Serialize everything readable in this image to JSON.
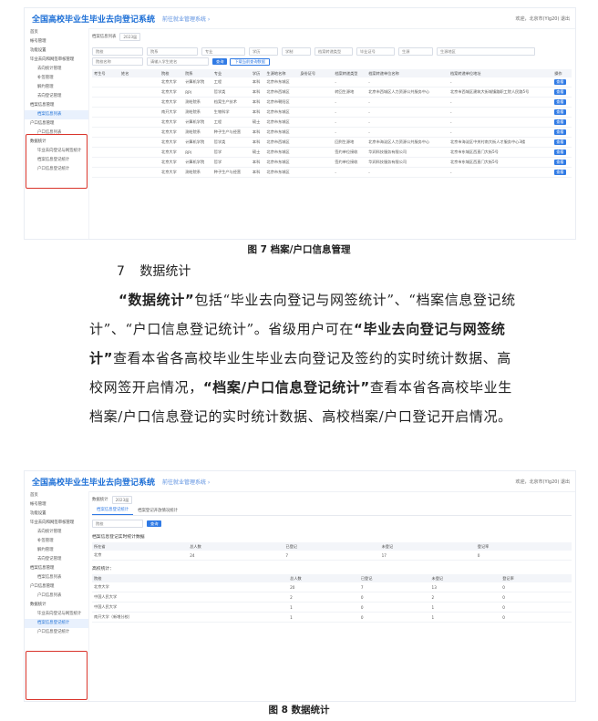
{
  "fig7": {
    "app_title": "全国高校毕业生毕业去向登记系统",
    "app_link": "前往就业管理系统 ›",
    "user": "欢迎，北京市(Ylg20)  退出",
    "year_label": "档案信息列表",
    "year_value": "2023届",
    "sidebar": [
      "首页",
      "帐号管理",
      "功能设置",
      "毕业去向和网签审核管理",
      "去向统计管理",
      "补签管理",
      "解约管理",
      "去向登记管理",
      "档案信息管理",
      "档案信息列表",
      "户口信息管理",
      "户口信息列表",
      "数据统计",
      "毕业去向登记与网签统计",
      "档案信息登记统计",
      "户口信息登记统计"
    ],
    "filters": [
      "院校",
      "院系",
      "专业",
      "学历",
      "学制",
      "档案转递类型",
      "毕业证号",
      "生源",
      "生源地区"
    ],
    "search_placeholder": "院校名称",
    "search_placeholder2": "请输入学生姓名",
    "search_btn": "查询",
    "export_btn": "下载当前查询数据",
    "headers": [
      "考生号",
      "姓名",
      "院校",
      "院系",
      "专业",
      "学历",
      "生源地名称",
      "身份证号",
      "档案转递类型",
      "档案转递单位名称",
      "档案转递单位地址",
      "操作"
    ],
    "rows": [
      [
        "",
        "",
        "北京大学",
        "计算机学院",
        "工程",
        "本科",
        "北京市东城区",
        "",
        "-",
        "-",
        "-",
        "查看"
      ],
      [
        "",
        "",
        "北京大学",
        "RPI",
        "哲学类",
        "本科",
        "北京市西城区",
        "",
        "转回生源地",
        "北京市西城区人力资源公共服务中心",
        "北京市西城区建筑大街城镇路职工院人民路5号",
        "查看"
      ],
      [
        "",
        "",
        "北京大学",
        "测绘院系",
        "档案生产技术",
        "本科",
        "北京市朝阳区",
        "",
        "-",
        "-",
        "-",
        "查看"
      ],
      [
        "",
        "",
        "南开大学",
        "测绘院系",
        "生物科学",
        "本科",
        "北京市东城区",
        "",
        "-",
        "-",
        "-",
        "查看"
      ],
      [
        "",
        "",
        "北京大学",
        "计算机学院",
        "工程",
        "硕士",
        "北京市东城区",
        "",
        "-",
        "-",
        "-",
        "查看"
      ],
      [
        "",
        "",
        "北京大学",
        "测绘院系",
        "种子生产与经营",
        "本科",
        "北京市东城区",
        "",
        "-",
        "-",
        "-",
        "查看"
      ],
      [
        "",
        "",
        "北京大学",
        "计算机学院",
        "哲学类",
        "本科",
        "北京市西城区",
        "",
        "回到生源地",
        "北京市海淀区人力资源公共服务中心",
        "北京市海淀区中关村南大街人才服务中心3楼",
        "查看"
      ],
      [
        "",
        "",
        "北京大学",
        "RPI",
        "哲学",
        "硕士",
        "北京市东城区",
        "",
        "签约单位接收",
        "华润科技服务有限公司",
        "北京市东城区西直门大街5号",
        "查看"
      ],
      [
        "",
        "",
        "北京大学",
        "计算机学院",
        "哲学",
        "本科",
        "北京市东城区",
        "",
        "签约单位接收",
        "华润科技服务有限公司",
        "北京市东城区西直门大街5号",
        "查看"
      ],
      [
        "",
        "",
        "北京大学",
        "测绘院系",
        "种子生产与经营",
        "本科",
        "北京市东城区",
        "",
        "-",
        "-",
        "-",
        "查看"
      ]
    ],
    "caption": "图 7  档案/户口信息管理"
  },
  "section": {
    "number": "7",
    "title": "数据统计"
  },
  "para": {
    "t1": "“数据统计”",
    "t2": "包括“毕业去向登记与网签统计”、“档案信息登记统计”、“户口信息登记统计”。省级用户可在",
    "t3": "“毕业去向登记与网签统计”",
    "t4": "查看本省各高校毕业生毕业去向登记及签约的实时统计数据、高校网签开启情况，",
    "t5": "“档案/户口信息登记统计”",
    "t6": "查看本省各高校毕业生档案/户口信息登记的实时统计数据、高校档案/户口登记开启情况。"
  },
  "fig8": {
    "app_title": "全国高校毕业生毕业去向登记系统",
    "app_link": "前往就业管理系统 ›",
    "user": "欢迎，北京市(Ylg20)  退出",
    "year_label": "数据统计",
    "year_value": "2023届",
    "tabs": [
      "档案信息登记统计",
      "档案登记开放情况统计"
    ],
    "select_placeholder": "院校",
    "query_btn": "查询",
    "summary_title": "档案信息登记实时统计数据",
    "summary_headers": [
      "所在省",
      "总人数",
      "已登记",
      "未登记",
      "登记率"
    ],
    "summary_row": [
      "北京",
      "24",
      "7",
      "17",
      "0"
    ],
    "detail_title": "高校统计：",
    "detail_headers": [
      "院校",
      "总人数",
      "已登记",
      "未登记",
      "登记率"
    ],
    "detail_rows": [
      [
        "北京大学",
        "20",
        "7",
        "13",
        "0"
      ],
      [
        "中国人民大学",
        "2",
        "0",
        "2",
        "0"
      ],
      [
        "中国人民大学",
        "1",
        "0",
        "1",
        "0"
      ],
      [
        "南开大学（新增分校）",
        "1",
        "0",
        "1",
        "0"
      ]
    ],
    "sidebar": [
      "首页",
      "帐号管理",
      "功能设置",
      "毕业去向和网签审核管理",
      "去向统计管理",
      "补签管理",
      "解约管理",
      "去向登记管理",
      "档案信息管理",
      "档案信息列表",
      "户口信息管理",
      "户口信息列表",
      "数据统计",
      "毕业去向登记与网签统计",
      "档案信息登记统计",
      "户口信息登记统计"
    ],
    "caption": "图 8  数据统计"
  }
}
